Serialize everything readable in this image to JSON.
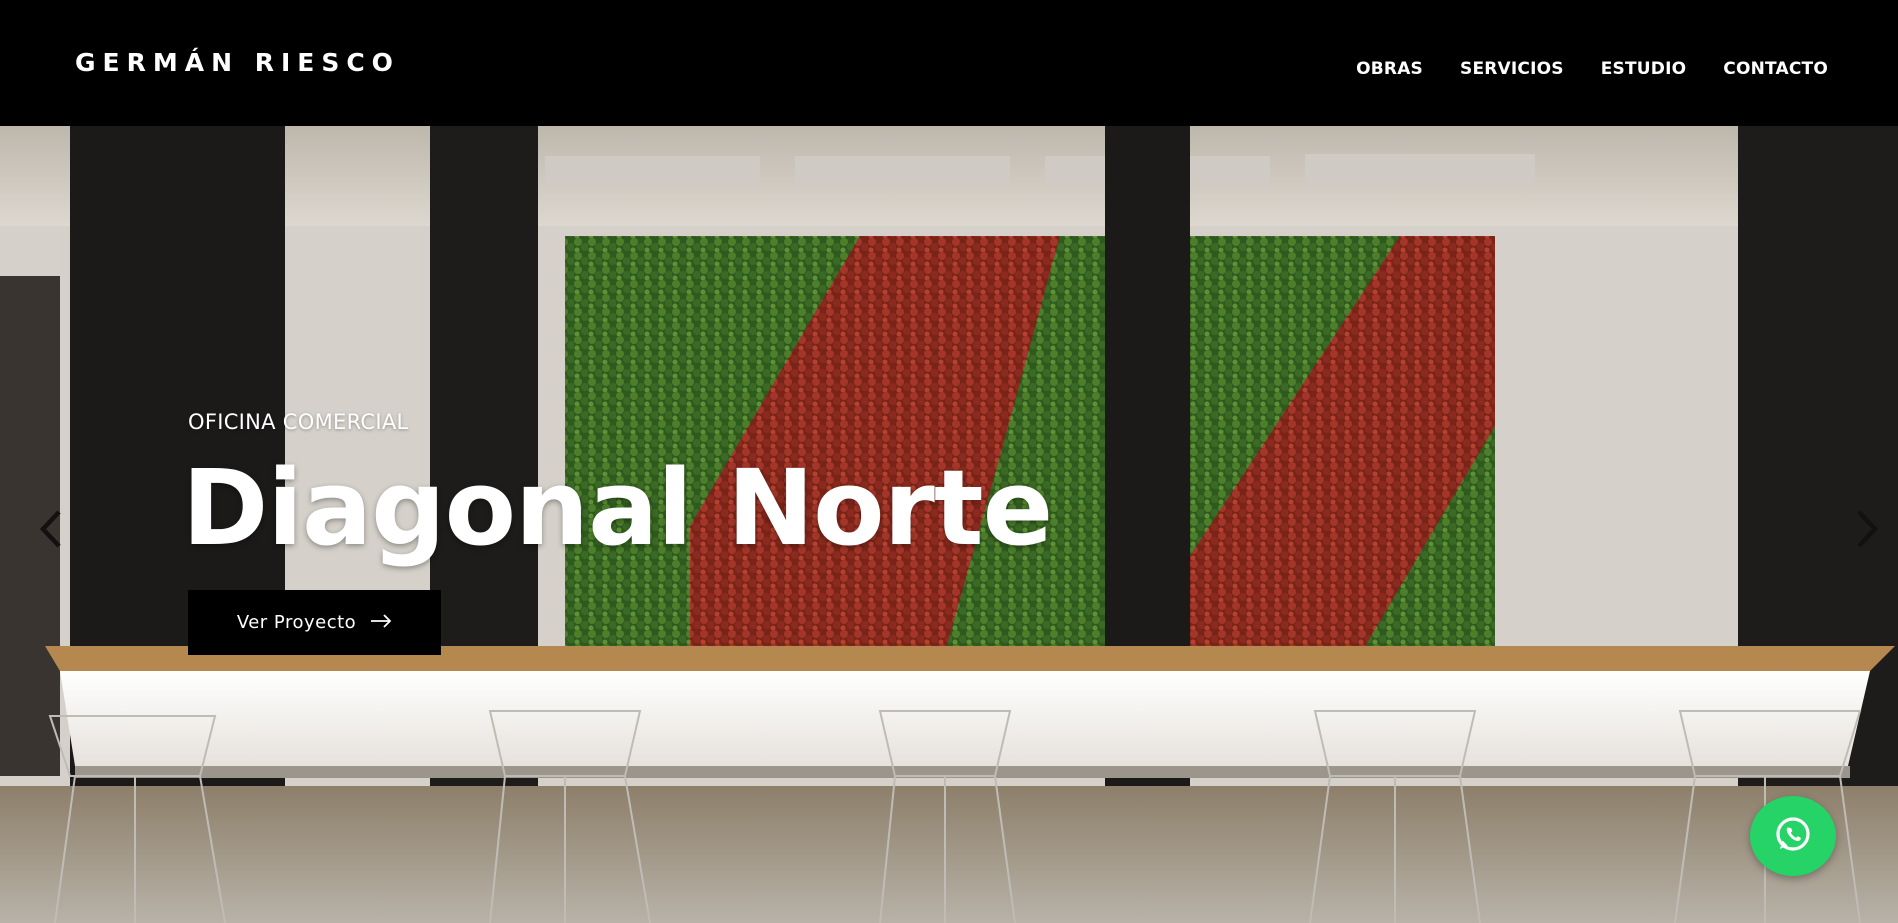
{
  "brand": {
    "name": "GERMÁN RIESCO"
  },
  "nav": {
    "items": [
      {
        "label": "OBRAS"
      },
      {
        "label": "SERVICIOS"
      },
      {
        "label": "ESTUDIO"
      },
      {
        "label": "CONTACTO"
      }
    ]
  },
  "hero": {
    "eyebrow": "OFICINA COMERCIAL",
    "title": "Diagonal Norte",
    "cta_label": "Ver Proyecto",
    "cta_icon": "arrow-right-icon",
    "prev_icon": "chevron-left-icon",
    "next_icon": "chevron-right-icon"
  },
  "whatsapp": {
    "icon": "whatsapp-icon",
    "color": "#25d366"
  },
  "colors": {
    "header_bg": "#000000",
    "text": "#ffffff",
    "cta_bg": "#000000"
  }
}
